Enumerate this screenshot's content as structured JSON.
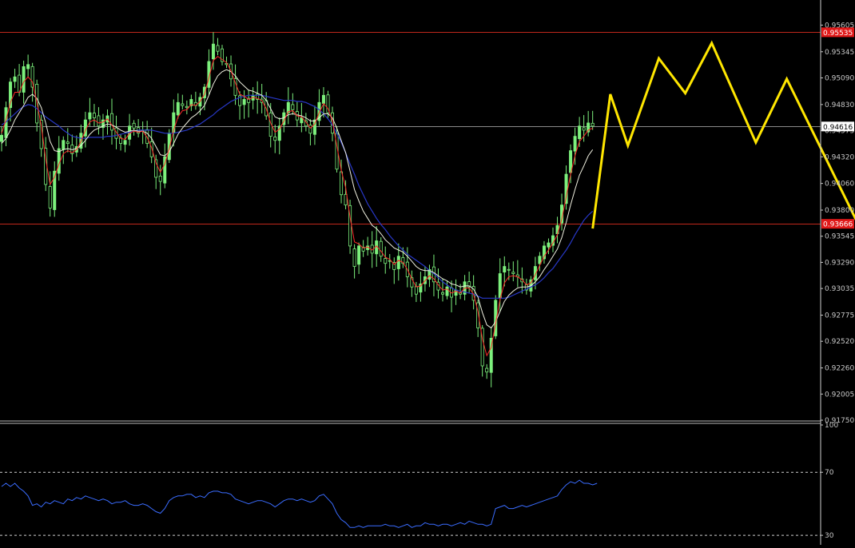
{
  "chart_data": [
    {
      "type": "candlestick",
      "panel": "main",
      "background": "#000000",
      "grid": false,
      "ylim": [
        0.9175,
        0.9585
      ],
      "y_ticks": [
        "0.95605",
        "0.95345",
        "0.95090",
        "0.94830",
        "0.94575",
        "0.94320",
        "0.94060",
        "0.93800",
        "0.93545",
        "0.93290",
        "0.93035",
        "0.92775",
        "0.92520",
        "0.92260",
        "0.92005",
        "0.91750"
      ],
      "price_labels": [
        {
          "name": "resistance",
          "value": 0.95535,
          "text": "0.95535",
          "color": "#ff2020",
          "line_color": "#c0281c"
        },
        {
          "name": "current-price",
          "value": 0.94616,
          "text": "0.94616",
          "color": "#ffffff",
          "line_color": "#8a8a8a"
        },
        {
          "name": "support",
          "value": 0.93666,
          "text": "0.93666",
          "color": "#ff2020",
          "line_color": "#c0281c"
        }
      ],
      "candle_color": "#7cf07c",
      "close_series": [
        0.9453,
        0.948,
        0.9505,
        0.951,
        0.9495,
        0.952,
        0.9522,
        0.95,
        0.9465,
        0.944,
        0.9405,
        0.9382,
        0.9418,
        0.944,
        0.9448,
        0.9445,
        0.9435,
        0.9442,
        0.9455,
        0.9468,
        0.9475,
        0.947,
        0.9462,
        0.9468,
        0.9472,
        0.9458,
        0.945,
        0.9445,
        0.9448,
        0.9462,
        0.946,
        0.9455,
        0.9458,
        0.9445,
        0.9432,
        0.9412,
        0.9408,
        0.9432,
        0.9455,
        0.9475,
        0.9485,
        0.9482,
        0.948,
        0.9488,
        0.9482,
        0.949,
        0.95,
        0.9525,
        0.9542,
        0.9535,
        0.9525,
        0.9522,
        0.9508,
        0.9492,
        0.9482,
        0.9488,
        0.9485,
        0.9492,
        0.9488,
        0.9485,
        0.9472,
        0.9452,
        0.9448,
        0.9462,
        0.9475,
        0.9485,
        0.9478,
        0.9468,
        0.947,
        0.9462,
        0.9455,
        0.9468,
        0.9485,
        0.9492,
        0.9475,
        0.9455,
        0.942,
        0.9395,
        0.9385,
        0.9345,
        0.9325,
        0.9345,
        0.934,
        0.9345,
        0.9338,
        0.935,
        0.9335,
        0.9328,
        0.933,
        0.9322,
        0.9335,
        0.9328,
        0.9315,
        0.9305,
        0.9298,
        0.9308,
        0.9315,
        0.9322,
        0.931,
        0.9302,
        0.9298,
        0.9305,
        0.9295,
        0.9302,
        0.9298,
        0.931,
        0.9305,
        0.9292,
        0.9265,
        0.9228,
        0.9222,
        0.9255,
        0.9292,
        0.9318,
        0.9325,
        0.9322,
        0.9318,
        0.9315,
        0.931,
        0.9302,
        0.9312,
        0.9325,
        0.9335,
        0.9345,
        0.9348,
        0.9355,
        0.9365,
        0.9385,
        0.9415,
        0.9438,
        0.9452,
        0.9462,
        0.9458,
        0.9465,
        0.9462
      ],
      "ema_fast": {
        "color": "#ff2a2a",
        "values": [
          0.9455,
          0.9468,
          0.9485,
          0.9495,
          0.9495,
          0.9505,
          0.951,
          0.9505,
          0.9485,
          0.9462,
          0.943,
          0.9405,
          0.9412,
          0.9425,
          0.9435,
          0.9438,
          0.9436,
          0.9439,
          0.9447,
          0.9458,
          0.9466,
          0.9468,
          0.9465,
          0.9466,
          0.9469,
          0.9463,
          0.9456,
          0.945,
          0.9449,
          0.9455,
          0.9457,
          0.9456,
          0.9457,
          0.9451,
          0.9441,
          0.9426,
          0.9417,
          0.9425,
          0.944,
          0.9458,
          0.9471,
          0.9477,
          0.9478,
          0.9483,
          0.9482,
          0.9486,
          0.9493,
          0.9509,
          0.9526,
          0.953,
          0.9527,
          0.9524,
          0.9516,
          0.9504,
          0.9493,
          0.9491,
          0.9488,
          0.949,
          0.9489,
          0.9487,
          0.9479,
          0.9465,
          0.9456,
          0.9459,
          0.9467,
          0.9476,
          0.9477,
          0.9472,
          0.9471,
          0.9466,
          0.946,
          0.9464,
          0.9475,
          0.9484,
          0.9479,
          0.9467,
          0.9443,
          0.9419,
          0.9402,
          0.9373,
          0.9349,
          0.9347,
          0.9343,
          0.9344,
          0.9341,
          0.9345,
          0.934,
          0.9334,
          0.9332,
          0.9327,
          0.9331,
          0.9329,
          0.9322,
          0.9313,
          0.9305,
          0.9306,
          0.9311,
          0.9316,
          0.9313,
          0.9307,
          0.9302,
          0.9303,
          0.9299,
          0.9301,
          0.9299,
          0.9304,
          0.9304,
          0.9298,
          0.9281,
          0.9254,
          0.9238,
          0.9246,
          0.9269,
          0.9293,
          0.9309,
          0.9315,
          0.9316,
          0.9315,
          0.9312,
          0.9307,
          0.9309,
          0.9317,
          0.9326,
          0.9335,
          0.9341,
          0.9348,
          0.9356,
          0.9371,
          0.9393,
          0.9415,
          0.9433,
          0.9447,
          0.9452,
          0.9458,
          0.946
        ]
      },
      "ema_mid": {
        "color": "#f0f0e0",
        "values": [
          0.9445,
          0.945,
          0.9458,
          0.9468,
          0.9475,
          0.9482,
          0.949,
          0.9493,
          0.9489,
          0.948,
          0.9465,
          0.9447,
          0.9438,
          0.9437,
          0.9439,
          0.944,
          0.9439,
          0.944,
          0.9443,
          0.9448,
          0.9454,
          0.9458,
          0.946,
          0.9462,
          0.9464,
          0.9463,
          0.9461,
          0.9458,
          0.9456,
          0.9457,
          0.9458,
          0.9457,
          0.9457,
          0.9455,
          0.945,
          0.9442,
          0.9434,
          0.9433,
          0.9437,
          0.9445,
          0.9454,
          0.946,
          0.9465,
          0.947,
          0.9473,
          0.9477,
          0.9482,
          0.9492,
          0.9503,
          0.9511,
          0.9515,
          0.9517,
          0.9515,
          0.9511,
          0.9505,
          0.9501,
          0.9497,
          0.9496,
          0.9494,
          0.9492,
          0.9487,
          0.9479,
          0.9471,
          0.9469,
          0.947,
          0.9473,
          0.9474,
          0.9473,
          0.9472,
          0.947,
          0.9467,
          0.9467,
          0.947,
          0.9474,
          0.9474,
          0.947,
          0.946,
          0.9448,
          0.9436,
          0.9418,
          0.94,
          0.9389,
          0.9379,
          0.9372,
          0.9365,
          0.9362,
          0.9357,
          0.9351,
          0.9347,
          0.9343,
          0.9341,
          0.9339,
          0.9335,
          0.933,
          0.9325,
          0.9322,
          0.9321,
          0.9321,
          0.9319,
          0.9316,
          0.9313,
          0.9311,
          0.9308,
          0.9307,
          0.9305,
          0.9306,
          0.9306,
          0.9303,
          0.9295,
          0.928,
          0.9268,
          0.9265,
          0.9271,
          0.9281,
          0.9291,
          0.9297,
          0.9301,
          0.9304,
          0.9305,
          0.9305,
          0.9306,
          0.931,
          0.9315,
          0.9322,
          0.9328,
          0.9335,
          0.9342,
          0.9353,
          0.9368,
          0.9385,
          0.94,
          0.9414,
          0.9423,
          0.9433,
          0.9439
        ]
      },
      "sma_slow": {
        "color": "#2838c8",
        "values": [
          0.9463,
          0.9466,
          0.947,
          0.9474,
          0.9478,
          0.9481,
          0.9483,
          0.9482,
          0.9479,
          0.9475,
          0.9471,
          0.9468,
          0.9465,
          0.9462,
          0.9458,
          0.9455,
          0.9452,
          0.9451,
          0.945,
          0.945,
          0.9451,
          0.9451,
          0.9451,
          0.9451,
          0.9452,
          0.9452,
          0.9453,
          0.9454,
          0.9455,
          0.9456,
          0.9457,
          0.9458,
          0.9458,
          0.9458,
          0.9458,
          0.9457,
          0.9456,
          0.9455,
          0.9455,
          0.9455,
          0.9456,
          0.9457,
          0.9458,
          0.946,
          0.9462,
          0.9464,
          0.9467,
          0.947,
          0.9473,
          0.9477,
          0.948,
          0.9483,
          0.9486,
          0.9488,
          0.949,
          0.9491,
          0.9492,
          0.9492,
          0.9492,
          0.9492,
          0.9491,
          0.949,
          0.9489,
          0.9488,
          0.9487,
          0.9487,
          0.9487,
          0.9486,
          0.9486,
          0.9485,
          0.9483,
          0.9481,
          0.9478,
          0.9474,
          0.9469,
          0.9463,
          0.9455,
          0.9446,
          0.9436,
          0.9425,
          0.9415,
          0.9404,
          0.9395,
          0.9386,
          0.9379,
          0.9372,
          0.9366,
          0.9361,
          0.9355,
          0.935,
          0.9345,
          0.9341,
          0.9337,
          0.9334,
          0.9331,
          0.9328,
          0.9325,
          0.9321,
          0.9318,
          0.9314,
          0.931,
          0.9307,
          0.9304,
          0.9302,
          0.9301,
          0.93,
          0.9299,
          0.9298,
          0.9296,
          0.9294,
          0.9294,
          0.9294,
          0.9294,
          0.9294,
          0.9294,
          0.9295,
          0.9297,
          0.9299,
          0.9301,
          0.9303,
          0.9305,
          0.9307,
          0.931,
          0.9314,
          0.9319,
          0.9323,
          0.9329,
          0.9335,
          0.9341,
          0.9348,
          0.9356,
          0.9363,
          0.937,
          0.9375,
          0.9379
        ]
      },
      "projection": {
        "color": "#ffe600",
        "points": [
          [
            134,
            0.9362
          ],
          [
            138,
            0.9493
          ],
          [
            142,
            0.9443
          ],
          [
            149,
            0.9528
          ],
          [
            155,
            0.9494
          ],
          [
            161,
            0.9543
          ],
          [
            171,
            0.9446
          ],
          [
            178,
            0.9508
          ],
          [
            194,
            0.9368
          ]
        ]
      }
    },
    {
      "type": "line",
      "panel": "oscillator",
      "ylim": [
        25,
        100
      ],
      "y_ticks": [
        "100",
        "70",
        "30"
      ],
      "levels": [
        70,
        30
      ],
      "line_color": "#3a6cff",
      "values": [
        61,
        63,
        61,
        63,
        60,
        58,
        55,
        49,
        50,
        48,
        51,
        50,
        52,
        51,
        50,
        53,
        52,
        54,
        53,
        55,
        54,
        53,
        52,
        53,
        52,
        50,
        51,
        51,
        52,
        50,
        49,
        49,
        50,
        49,
        47,
        45,
        44,
        47,
        52,
        54,
        55,
        55,
        56,
        56,
        54,
        55,
        54,
        57,
        58,
        58,
        57,
        57,
        56,
        53,
        52,
        51,
        50,
        51,
        52,
        52,
        51,
        50,
        48,
        50,
        52,
        53,
        53,
        52,
        53,
        52,
        51,
        52,
        55,
        56,
        53,
        50,
        44,
        40,
        38,
        35,
        35,
        36,
        35,
        36,
        36,
        36,
        36,
        37,
        36,
        36,
        35,
        36,
        37,
        35,
        36,
        36,
        38,
        37,
        37,
        36,
        37,
        37,
        36,
        37,
        38,
        37,
        39,
        38,
        37,
        37,
        36,
        37,
        47,
        48,
        49,
        47,
        47,
        48,
        49,
        48,
        49,
        50,
        51,
        52,
        53,
        54,
        55,
        59,
        62,
        64,
        63,
        65,
        63,
        63,
        62,
        63
      ]
    }
  ]
}
